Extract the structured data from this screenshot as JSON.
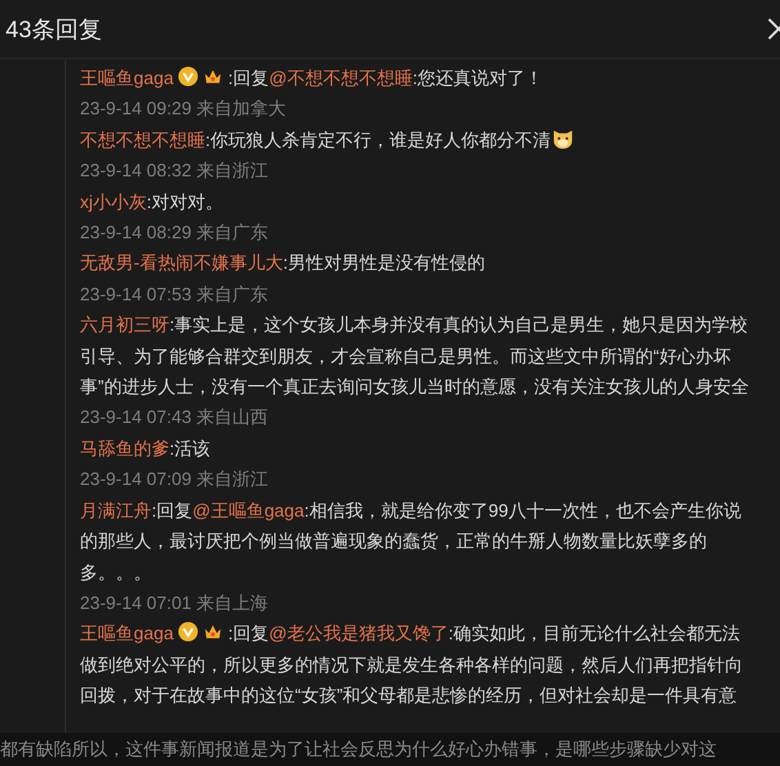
{
  "header": {
    "title": "43条回复"
  },
  "comments": [
    {
      "author": "王嘔鱼gaga",
      "verified": true,
      "crown": true,
      "reply_label": ":回复",
      "reply_to": "@不想不想不想睡",
      "text": ":您还真说对了！",
      "emoji": false,
      "time": "23-9-14 09:29 来自加拿大"
    },
    {
      "author": "不想不想不想睡",
      "verified": false,
      "crown": false,
      "text": ":你玩狼人杀肯定不行，谁是好人你都分不清",
      "emoji": true,
      "time": "23-9-14 08:32 来自浙江"
    },
    {
      "author": "xj小小灰",
      "verified": false,
      "crown": false,
      "text": ":对对对。",
      "emoji": false,
      "time": "23-9-14 08:29 来自广东"
    },
    {
      "author": "无敌男-看热闹不嫌事儿大",
      "verified": false,
      "crown": false,
      "text": ":男性对男性是没有性侵的",
      "emoji": false,
      "time": "23-9-14 07:53 来自广东"
    },
    {
      "author": "六月初三呀",
      "verified": false,
      "crown": false,
      "text": ":事实上是，这个女孩儿本身并没有真的认为自己是男生，她只是因为学校引导、为了能够合群交到朋友，才会宣称自己是男性。而这些文中所谓的“好心办坏事”的进步人士，没有一个真正去询问女孩儿当时的意愿，没有关注女孩儿的人身安全",
      "emoji": false,
      "time": "23-9-14 07:43 来自山西"
    },
    {
      "author": "马舔鱼的爹",
      "verified": false,
      "crown": false,
      "text": ":活该",
      "emoji": false,
      "time": "23-9-14 07:09 来自浙江"
    },
    {
      "author": "月满江舟",
      "verified": false,
      "crown": false,
      "reply_label": ":回复",
      "reply_to": "@王嘔鱼gaga",
      "text": ":相信我，就是给你变了99八十一次性，也不会产生你说的那些人，最讨厌把个例当做普遍现象的蠢货，正常的牛掰人物数量比妖孽多的多。。。",
      "emoji": false,
      "time": "23-9-14 07:01 来自上海"
    },
    {
      "author": "王嘔鱼gaga",
      "verified": true,
      "crown": true,
      "reply_label": ":回复",
      "reply_to": "@老公我是猪我又馋了",
      "text": ":确实如此，目前无论什么社会都无法做到绝对公平的，所以更多的情况下就是发生各种各样的问题，然后人们再把指针向回拨，对于在故事中的这位“女孩”和父母都是悲惨的经历，但对社会却是一件具有意",
      "emoji": false
    }
  ],
  "footer_text": "都有缺陷所以，这件事新闻报道是为了让社会反思为什么好心办错事，是哪些步骤缺少对这"
}
